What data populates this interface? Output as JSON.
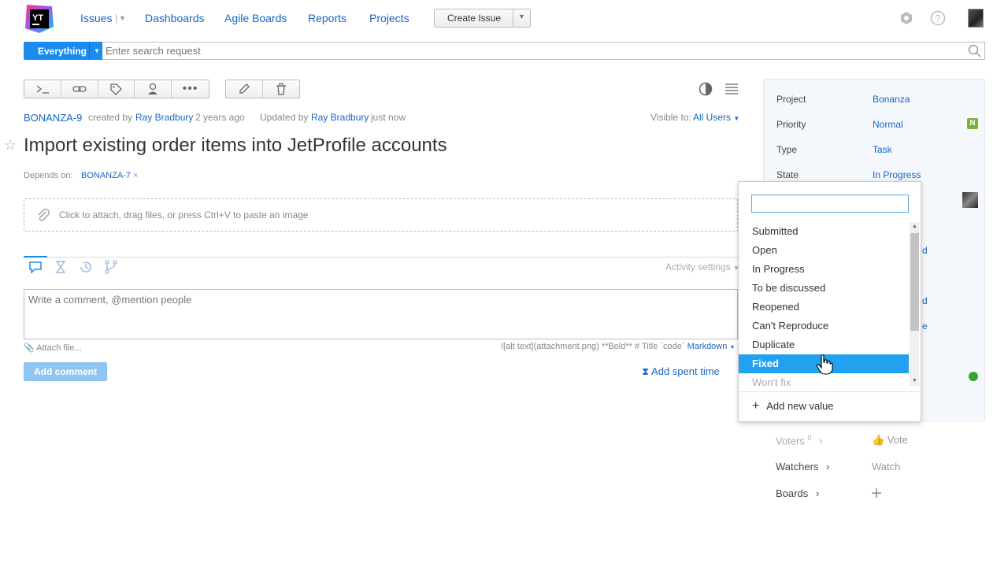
{
  "app": {
    "logo_text": "YT"
  },
  "nav": {
    "issues": "Issues",
    "dashboards": "Dashboards",
    "agile_boards": "Agile Boards",
    "reports": "Reports",
    "projects": "Projects",
    "create_issue": "Create Issue"
  },
  "search": {
    "context": "Everything",
    "placeholder": "Enter search request"
  },
  "issue": {
    "id": "BONANZA-9",
    "created_by_prefix": "created by",
    "creator": "Ray Bradbury",
    "created_when": "2 years ago",
    "updated_prefix": "Updated by",
    "updater": "Ray Bradbury",
    "updated_when": "just now",
    "visible_to_label": "Visible to:",
    "visible_to_value": "All Users",
    "title": "Import existing order items into JetProfile accounts",
    "depends_label": "Depends on:",
    "depends_value": "BONANZA-7",
    "attach_hint": "Click to attach, drag files, or press Ctrl+V to paste an image"
  },
  "activity": {
    "settings": "Activity settings"
  },
  "comment": {
    "placeholder": "Write a comment, @mention people",
    "attach_file": "Attach file...",
    "markdown_hint": "![alt text](attachment.png) **Bold** # Title `code`",
    "markdown_label": "Markdown",
    "add_comment": "Add comment",
    "add_spent_time": "Add spent time"
  },
  "fields": {
    "project": {
      "label": "Project",
      "value": "Bonanza"
    },
    "priority": {
      "label": "Priority",
      "value": "Normal",
      "badge": "N"
    },
    "type": {
      "label": "Type",
      "value": "Task"
    },
    "state": {
      "label": "State",
      "value": "In Progress"
    },
    "partial_1": "d",
    "partial_2": "d",
    "partial_3": "e"
  },
  "bottom": {
    "voters": "Voters",
    "voters_count": "0",
    "vote": "Vote",
    "watchers": "Watchers",
    "watch": "Watch",
    "boards": "Boards"
  },
  "dropdown": {
    "input_value": "",
    "items": [
      "Submitted",
      "Open",
      "In Progress",
      "To be discussed",
      "Reopened",
      "Can't Reproduce",
      "Duplicate",
      "Fixed",
      "Won't fix"
    ],
    "selected": "Fixed",
    "add_new": "Add new value"
  },
  "colors": {
    "accent": "#1a8cf0",
    "link": "#1a66c1",
    "selected_row": "#22a1f0",
    "priority_badge": "#77b72c"
  }
}
